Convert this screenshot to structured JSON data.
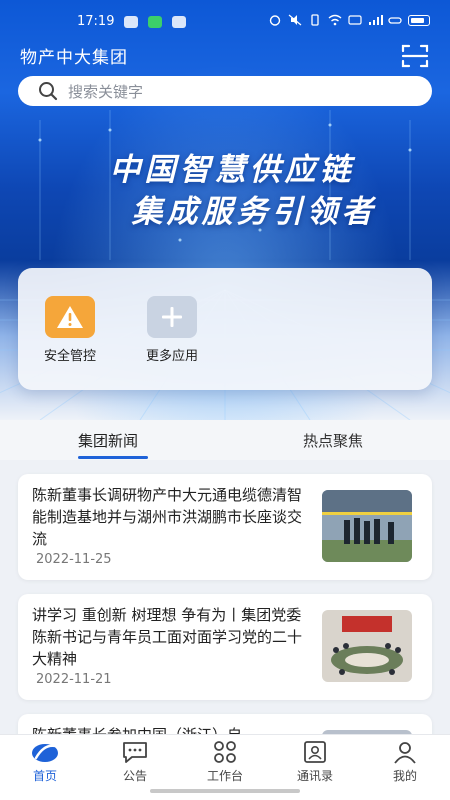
{
  "status": {
    "time": "17:19"
  },
  "header": {
    "brand": "物产中大集团",
    "search_placeholder": "搜索关键字"
  },
  "banner": {
    "line1": "中国智慧供应链",
    "line2": "集成服务引领者"
  },
  "apps": [
    {
      "label": "安全管控",
      "icon": "warning-icon",
      "color": "#f5a63a"
    },
    {
      "label": "更多应用",
      "icon": "plus-icon",
      "color": "#c9d3e2"
    }
  ],
  "tabs": [
    {
      "label": "集团新闻",
      "active": true
    },
    {
      "label": "热点聚焦",
      "active": false
    }
  ],
  "news": [
    {
      "title": "陈新董事长调研物产中大元通电缆德清智能制造基地并与湖州市洪湖鹏市长座谈交流",
      "date": "2022-11-25"
    },
    {
      "title": "讲学习 重创新 树理想 争有为丨集团党委陈新书记与青年员工面对面学习党的二十大精神",
      "date": "2022-11-21"
    },
    {
      "title": "陈新董事长参加中国（浙江）自",
      "date": ""
    }
  ],
  "nav": [
    {
      "label": "首页",
      "icon": "home-icon",
      "active": true
    },
    {
      "label": "公告",
      "icon": "announcement-icon",
      "active": false
    },
    {
      "label": "工作台",
      "icon": "workbench-icon",
      "active": false
    },
    {
      "label": "通讯录",
      "icon": "contacts-icon",
      "active": false
    },
    {
      "label": "我的",
      "icon": "profile-icon",
      "active": false
    }
  ],
  "colors": {
    "primary": "#1e62d8",
    "hero": "#0e47b4",
    "warning": "#f5a63a"
  }
}
